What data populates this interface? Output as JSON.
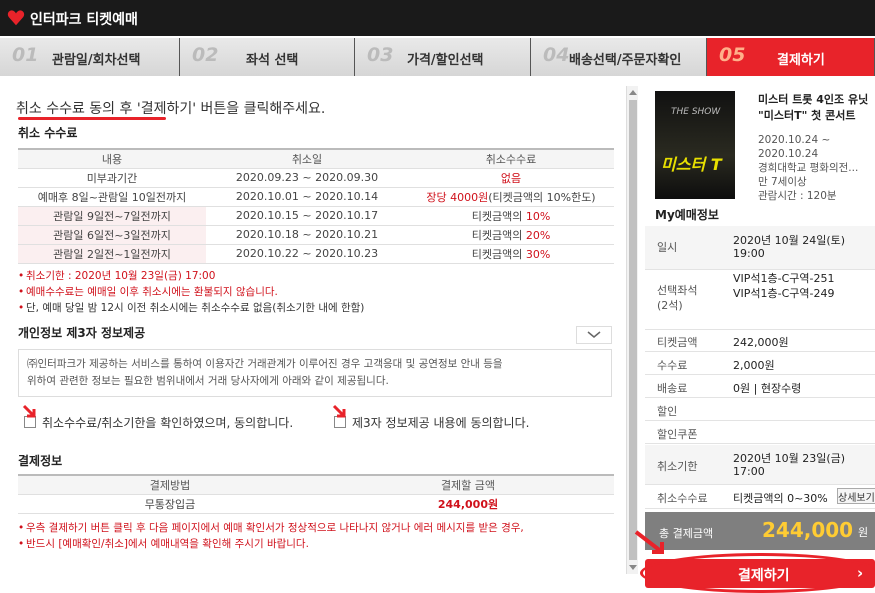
{
  "app": {
    "title": "인터파크 티켓예매"
  },
  "steps": [
    {
      "num": "01",
      "label": "관람일/회차선택"
    },
    {
      "num": "02",
      "label": "좌석 선택"
    },
    {
      "num": "03",
      "label": "가격/할인선택"
    },
    {
      "num": "04",
      "label": "배송선택/주문자확인"
    },
    {
      "num": "05",
      "label": "결제하기"
    }
  ],
  "instruction": {
    "prefix": "취소 수수료 동의 후",
    "suffix": " '결제하기' 버튼을 클릭해주세요."
  },
  "cancel_fee": {
    "title": "취소 수수료",
    "headers": [
      "내용",
      "취소일",
      "취소수수료"
    ],
    "rows": [
      {
        "content": "미부과기간",
        "date": "2020.09.23 ~ 2020.09.30",
        "fee": "없음",
        "fee_prefix": "",
        "pink": false
      },
      {
        "content": "예매후 8일~관람일 10일전까지",
        "date": "2020.10.01 ~ 2020.10.14",
        "fee": "장당 4000원",
        "fee_suffix": "(티켓금액의 10%한도)",
        "pink": false
      },
      {
        "content": "관람일 9일전~7일전까지",
        "date": "2020.10.15 ~ 2020.10.17",
        "fee_prefix": "티켓금액의 ",
        "fee": "10%",
        "pink": true
      },
      {
        "content": "관람일 6일전~3일전까지",
        "date": "2020.10.18 ~ 2020.10.21",
        "fee_prefix": "티켓금액의 ",
        "fee": "20%",
        "pink": true
      },
      {
        "content": "관람일 2일전~1일전까지",
        "date": "2020.10.22 ~ 2020.10.23",
        "fee_prefix": "티켓금액의 ",
        "fee": "30%",
        "pink": true
      }
    ],
    "notes": [
      "취소기한 : 2020년 10월 23일(금) 17:00",
      "예매수수료는 예매일 이후 취소시에는 환불되지 않습니다.",
      "단, 예매 당일 밤 12시 이전 취소시에는 취소수수료 없음(취소기한 내에 한함)"
    ]
  },
  "privacy": {
    "title": "개인정보 제3자 정보제공",
    "text_line1": "㈜인터파크가 제공하는 서비스를 통하여 이용자간 거래관계가 이루어진 경우 고객응대 및 공연정보 안내 등을",
    "text_line2": "위하여 관련한 정보는 필요한 범위내에서 거래 당사자에게 아래와 같이 제공됩니다."
  },
  "agreements": {
    "cancel_agree": "취소수수료/취소기한을 확인하였으며, 동의합니다.",
    "third_party_agree": "제3자 정보제공 내용에 동의합니다."
  },
  "payment": {
    "title": "결제정보",
    "headers": [
      "결제방법",
      "결제할 금액"
    ],
    "method": "무통장입금",
    "amount": "244,000원",
    "note_line1": "우측 결제하기 버튼 클릭 후 다음 페이지에서 예매 확인서가 정상적으로 나타나지 않거나 에러 메시지를 받은 경우,",
    "note_line2": "반드시 [예매확인/취소]에서 예매내역을 확인해 주시기 바랍니다."
  },
  "performance": {
    "title_line1": "미스터 트롯 4인조 유닛",
    "title_line2": "\"미스터T\" 첫 콘서트",
    "date_from": "2020.10.24 ~",
    "date_to": "2020.10.24",
    "venue": "경희대학교 평화의전...",
    "age": "만 7세이상",
    "runtime": "관람시간 : 120분",
    "poster_text": "미스터 T",
    "poster_sub": "THE SHOW"
  },
  "my_booking": {
    "title": "My예매정보",
    "date_label": "일시",
    "date_value_1": "2020년 10월 24일(토)",
    "date_value_2": "19:00",
    "seat_label": "선택좌석",
    "seat_count": "(2석)",
    "seat_1": "VIP석1층-C구역-251",
    "seat_2": "VIP석1층-C구역-249",
    "ticket_label": "티켓금액",
    "ticket_value": "242,000원",
    "fee_label": "수수료",
    "fee_value": "2,000원",
    "delivery_label": "배송료",
    "delivery_value": "0원 | 현장수령",
    "discount_label": "할인",
    "coupon_label": "할인쿠폰",
    "deadline_label": "취소기한",
    "deadline_1": "2020년 10월 23일(금)",
    "deadline_2": "17:00",
    "cancel_fee_label": "취소수수료",
    "cancel_fee_value": "티켓금액의 0~30%",
    "detail_btn": "상세보기",
    "total_label": "총 결제금액",
    "total_value": "244,000",
    "total_unit": "원",
    "pay_button": "결제하기"
  },
  "colors": {
    "accent": "#e8232a",
    "highlight_red": "#d0111b",
    "total_yellow": "#ffcc33"
  }
}
